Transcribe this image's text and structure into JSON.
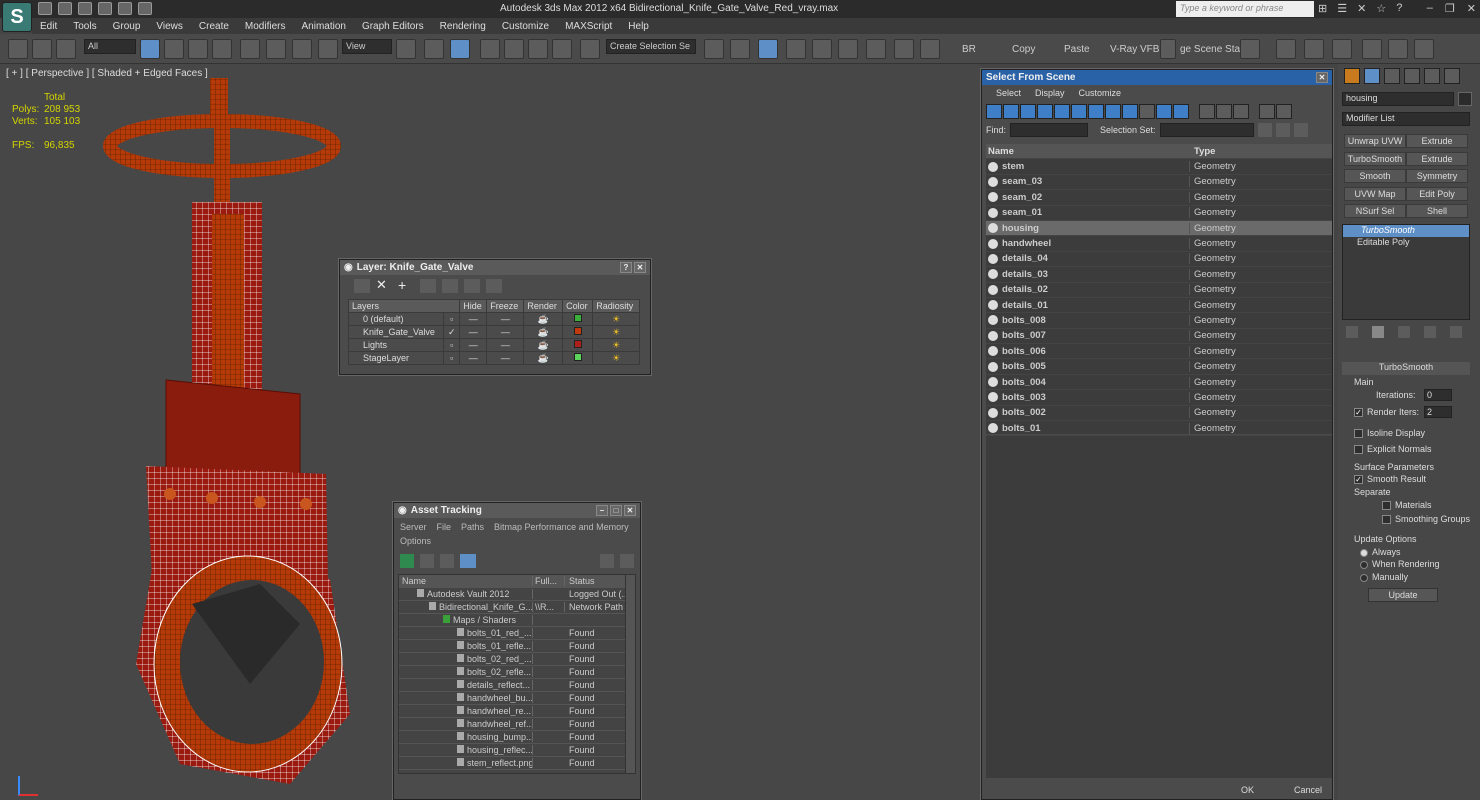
{
  "app": {
    "title": "Autodesk 3ds Max  2012 x64     Bidirectional_Knife_Gate_Valve_Red_vray.max",
    "search_placeholder": "Type a keyword or phrase",
    "logo": "S"
  },
  "menu": [
    "Edit",
    "Tools",
    "Group",
    "Views",
    "Create",
    "Modifiers",
    "Animation",
    "Graph Editors",
    "Rendering",
    "Customize",
    "MAXScript",
    "Help"
  ],
  "toolbar": {
    "filter": "All",
    "ref_coord": "View",
    "selection_set": "Create Selection Se",
    "br": "BR",
    "copy": "Copy",
    "paste": "Paste",
    "vray_vfb": "V-Ray VFB",
    "scene_states": "ge Scene Stat"
  },
  "viewport": {
    "label": "[ + ] [ Perspective ] [ Shaded + Edged Faces ]",
    "stats_header": "Total",
    "polys_label": "Polys:",
    "polys": "208 953",
    "verts_label": "Verts:",
    "verts": "105 103",
    "fps_label": "FPS:",
    "fps": "96,835"
  },
  "layer_dialog": {
    "title": "Layer: Knife_Gate_Valve",
    "columns": [
      "Layers",
      "Hide",
      "Freeze",
      "Render",
      "Color",
      "Radiosity"
    ],
    "rows": [
      {
        "name": "0 (default)",
        "color": "#3cae3c",
        "current": false
      },
      {
        "name": "Knife_Gate_Valve",
        "color": "#c03a10",
        "current": true
      },
      {
        "name": "Lights",
        "color": "#b0201a",
        "current": false
      },
      {
        "name": "StageLayer",
        "color": "#5ad45a",
        "current": false
      }
    ]
  },
  "asset_tracking": {
    "title": "Asset Tracking",
    "menu": [
      "Server",
      "File",
      "Paths",
      "Bitmap Performance and Memory",
      "Options"
    ],
    "columns": [
      "Name",
      "Full...",
      "Status"
    ],
    "rows": [
      {
        "name": "Autodesk Vault 2012",
        "full": "",
        "status": "Logged Out (..."
      },
      {
        "name": "Bidirectional_Knife_G...",
        "full": "\\\\R...",
        "status": "Network Path"
      },
      {
        "name": "Maps / Shaders",
        "full": "",
        "status": ""
      },
      {
        "name": "bolts_01_red_...",
        "full": "",
        "status": "Found"
      },
      {
        "name": "bolts_01_refle...",
        "full": "",
        "status": "Found"
      },
      {
        "name": "bolts_02_red_...",
        "full": "",
        "status": "Found"
      },
      {
        "name": "bolts_02_refle...",
        "full": "",
        "status": "Found"
      },
      {
        "name": "details_reflect...",
        "full": "",
        "status": "Found"
      },
      {
        "name": "handwheel_bu...",
        "full": "",
        "status": "Found"
      },
      {
        "name": "handwheel_re...",
        "full": "",
        "status": "Found"
      },
      {
        "name": "handwheel_ref...",
        "full": "",
        "status": "Found"
      },
      {
        "name": "housing_bump...",
        "full": "",
        "status": "Found"
      },
      {
        "name": "housing_reflec...",
        "full": "",
        "status": "Found"
      },
      {
        "name": "stem_reflect.png",
        "full": "",
        "status": "Found"
      }
    ]
  },
  "select_from_scene": {
    "title": "Select From Scene",
    "menu": [
      "Select",
      "Display",
      "Customize"
    ],
    "find_label": "Find:",
    "selection_set_label": "Selection Set:",
    "col_name": "Name",
    "col_type": "Type",
    "ok": "OK",
    "cancel": "Cancel",
    "rows": [
      {
        "name": "stem",
        "type": "Geometry",
        "selected": false
      },
      {
        "name": "seam_03",
        "type": "Geometry",
        "selected": false
      },
      {
        "name": "seam_02",
        "type": "Geometry",
        "selected": false
      },
      {
        "name": "seam_01",
        "type": "Geometry",
        "selected": false
      },
      {
        "name": "housing",
        "type": "Geometry",
        "selected": true
      },
      {
        "name": "handwheel",
        "type": "Geometry",
        "selected": false
      },
      {
        "name": "details_04",
        "type": "Geometry",
        "selected": false
      },
      {
        "name": "details_03",
        "type": "Geometry",
        "selected": false
      },
      {
        "name": "details_02",
        "type": "Geometry",
        "selected": false
      },
      {
        "name": "details_01",
        "type": "Geometry",
        "selected": false
      },
      {
        "name": "bolts_008",
        "type": "Geometry",
        "selected": false
      },
      {
        "name": "bolts_007",
        "type": "Geometry",
        "selected": false
      },
      {
        "name": "bolts_006",
        "type": "Geometry",
        "selected": false
      },
      {
        "name": "bolts_005",
        "type": "Geometry",
        "selected": false
      },
      {
        "name": "bolts_004",
        "type": "Geometry",
        "selected": false
      },
      {
        "name": "bolts_003",
        "type": "Geometry",
        "selected": false
      },
      {
        "name": "bolts_002",
        "type": "Geometry",
        "selected": false
      },
      {
        "name": "bolts_01",
        "type": "Geometry",
        "selected": false
      }
    ]
  },
  "command_panel": {
    "object_name": "housing",
    "modifier_list": "Modifier List",
    "buttons": [
      "Unwrap UVW",
      "Extrude",
      "TurboSmooth",
      "Extrude",
      "Smooth",
      "Symmetry",
      "UVW Map",
      "Edit Poly",
      "NSurf Sel",
      "Shell"
    ],
    "stack": [
      "TurboSmooth",
      "Editable Poly"
    ],
    "rollout_title": "TurboSmooth",
    "main_label": "Main",
    "iterations_label": "Iterations:",
    "iterations": "0",
    "render_iters_label": "Render Iters:",
    "render_iters": "2",
    "isoline": "Isoline Display",
    "explicit_normals": "Explicit Normals",
    "surface_params": "Surface Parameters",
    "smooth_result": "Smooth Result",
    "separate": "Separate",
    "materials": "Materials",
    "smoothing_groups": "Smoothing Groups",
    "update_options": "Update Options",
    "always": "Always",
    "when_rendering": "When Rendering",
    "manually": "Manually",
    "update": "Update"
  }
}
